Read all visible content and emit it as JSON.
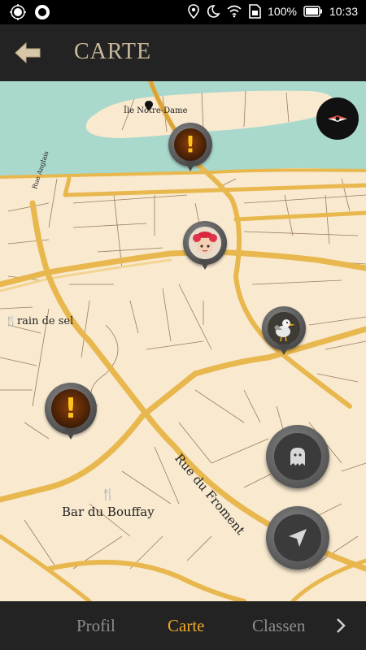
{
  "status_bar": {
    "battery": "100%",
    "time": "10:33"
  },
  "header": {
    "title": "CARTE",
    "back_icon": "back-arrow-icon"
  },
  "map": {
    "labels": {
      "ile": "Île Notre-Dame",
      "rue_anglais": "Rue Anglais",
      "grain_de_sel": "rain de sel",
      "bar": "Bar du Bouffay",
      "rue_froment": "Rue du Froment"
    },
    "markers": [
      {
        "type": "quest-alert",
        "icon": "exclamation-icon"
      },
      {
        "type": "character",
        "icon": "red-haired-character-avatar"
      },
      {
        "type": "character",
        "icon": "seagull-avatar"
      },
      {
        "type": "quest-alert",
        "icon": "exclamation-icon"
      }
    ],
    "colors": {
      "land": "#f8e9cf",
      "water": "#a9d8cd",
      "road": "#e8b74e",
      "alert": "#ffc21a"
    }
  },
  "buttons": {
    "compass_icon": "compass-icon",
    "ghost_icon": "ghost-icon",
    "locate_icon": "navigation-arrow-icon"
  },
  "bottom_nav": {
    "items": [
      "Profil",
      "Carte",
      "Classen"
    ],
    "active": "Carte",
    "next_icon": "chevron-right-icon"
  }
}
